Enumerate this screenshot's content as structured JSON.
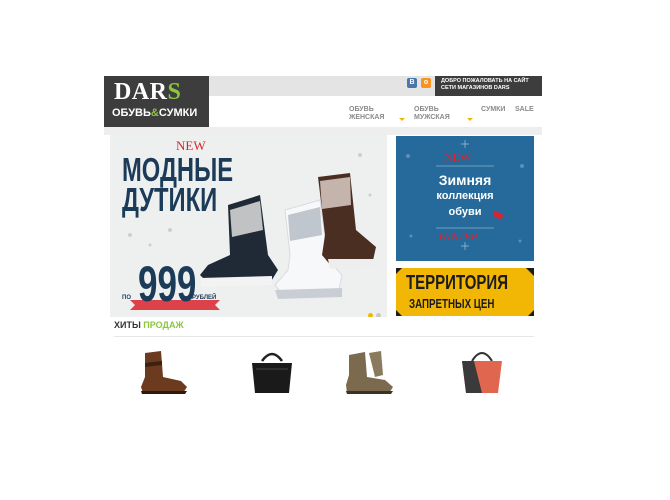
{
  "brand": {
    "logo_top": "DAR",
    "logo_top_accent": "S",
    "logo_bottom_a": "ОБУВЬ",
    "logo_bottom_amp": "&",
    "logo_bottom_b": "СУМКИ"
  },
  "social": [
    {
      "label": "В",
      "color": "#4a76a8"
    },
    {
      "label": "о",
      "color": "#f7931e"
    }
  ],
  "welcome": {
    "line1": "ДОБРО ПОЖАЛОВАТЬ НА САЙТ",
    "line2": "СЕТИ МАГАЗИНОВ DARS"
  },
  "nav": [
    {
      "line1": "ОБУВЬ",
      "line2": "ЖЕНСКАЯ",
      "has_dropdown": true
    },
    {
      "line1": "ОБУВЬ",
      "line2": "МУЖСКАЯ",
      "has_dropdown": true
    },
    {
      "line1": "СУМКИ",
      "line2": ""
    },
    {
      "line1": "SALE",
      "line2": ""
    }
  ],
  "main_banner": {
    "new": "NEW",
    "line1": "МОДНЫЕ",
    "line2": "ДУТИКИ",
    "price_prefix": "ПО",
    "price": "999",
    "price_suffix": "РУБЛЕЙ",
    "slides": 2,
    "active_slide": 1
  },
  "winter_banner": {
    "new": "NEW",
    "line1": "Зимняя",
    "line2": "коллекция",
    "line3": "обуви",
    "winter": "WINTER"
  },
  "territory_banner": {
    "line1": "ТЕРРИТОРИЯ",
    "line2": "ЗАПРЕТНЫХ ЦЕН"
  },
  "hits": {
    "title_a": "ХИТЫ",
    "title_b": "ПРОДАЖ"
  },
  "products": [
    {
      "name": "brown-boot-icon"
    },
    {
      "name": "black-bag-icon"
    },
    {
      "name": "khaki-boot-icon"
    },
    {
      "name": "coral-bag-icon"
    }
  ],
  "colors": {
    "accent": "#8cc63f",
    "dark": "#3d3d3d",
    "navy": "#1b3b59",
    "yellow": "#f2b705",
    "red": "#d9232e",
    "winter_blue": "#256a9a"
  }
}
